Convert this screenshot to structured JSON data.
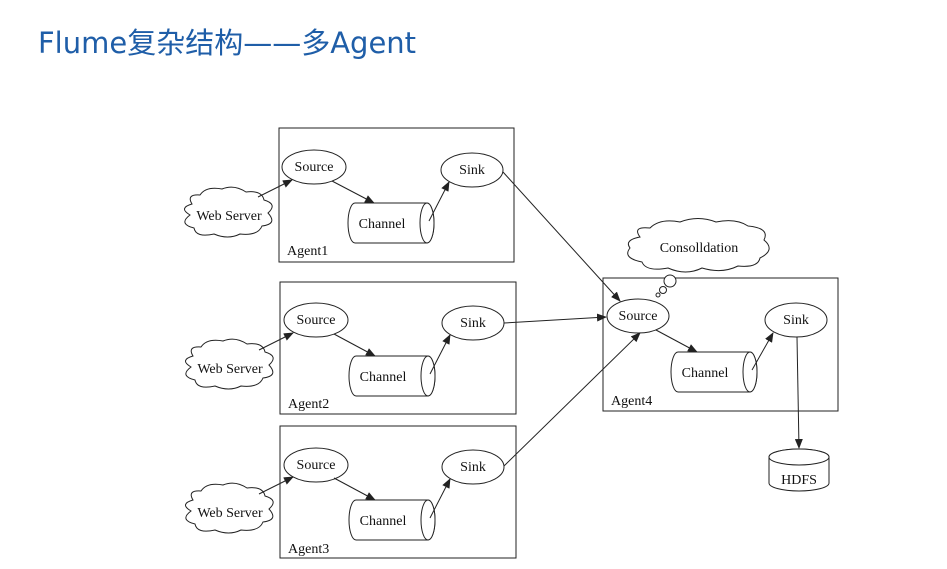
{
  "title": "Flume复杂结构——多Agent",
  "diagram": {
    "agents": [
      {
        "label": "Agent1",
        "source": "Source",
        "channel": "Channel",
        "sink": "Sink",
        "web_server": "Web Server"
      },
      {
        "label": "Agent2",
        "source": "Source",
        "channel": "Channel",
        "sink": "Sink",
        "web_server": "Web Server"
      },
      {
        "label": "Agent3",
        "source": "Source",
        "channel": "Channel",
        "sink": "Sink",
        "web_server": "Web Server"
      }
    ],
    "collector": {
      "label": "Agent4",
      "source": "Source",
      "channel": "Channel",
      "sink": "Sink",
      "cloud": "Consolldation",
      "storage": "HDFS"
    }
  }
}
